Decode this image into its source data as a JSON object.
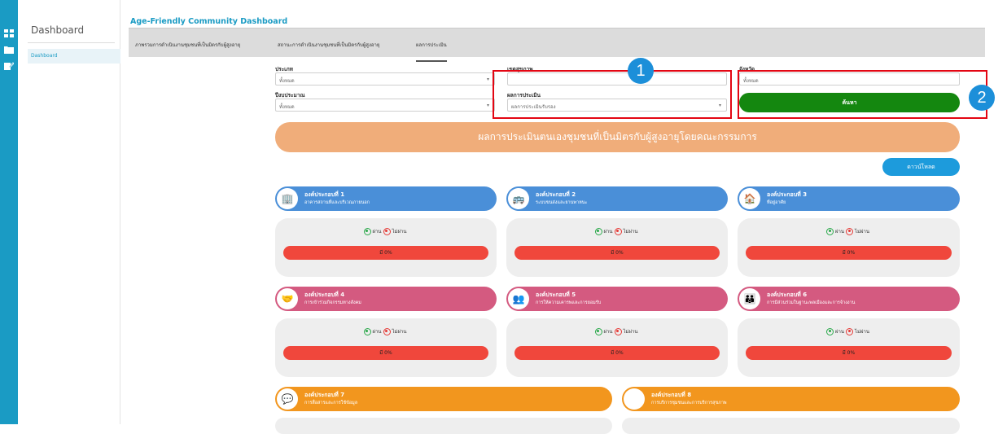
{
  "sidebar": {
    "title": "Dashboard",
    "items": [
      {
        "label": "Dashboard"
      }
    ]
  },
  "app_title": "Age-Friendly Community Dashboard",
  "tabs": [
    {
      "label": "ภาพรวมการดำเนินงานชุมชนที่เป็นมิตรกับผู้สูงอายุ"
    },
    {
      "label": "สถานะการดำเนินงานชุมชนที่เป็นมิตรกับผู้สูงอายุ"
    },
    {
      "label": "ผลการประเมิน"
    }
  ],
  "filters": {
    "type": {
      "label": "ประเภท",
      "value": "ทั้งหมด"
    },
    "health_zone": {
      "label": "เขตสุขภาพ",
      "value": ""
    },
    "province": {
      "label": "จังหวัด",
      "value": "ทั้งหมด"
    },
    "fiscal_year": {
      "label": "ปีงบประมาณ",
      "value": "ทั้งหมด"
    },
    "result": {
      "label": "ผลการประเมิน",
      "value": "ผลการประเมินรับรอง"
    }
  },
  "search_button": "ค้นหา",
  "annotations": [
    "1",
    "2"
  ],
  "banner": "ผลการประเมินตนเองชุมชนที่เป็นมิตรกับผู้สูงอายุโดยคณะกรรมการ",
  "download_button": "ดาวน์โหลด",
  "pass_label": "ผ่าน",
  "fail_label": "ไม่ผ่าน",
  "colors": {
    "blue": "#4a8fd8",
    "pink": "#d45a80",
    "orange": "#f2961e",
    "green": "#14870f",
    "red": "#f0473c"
  },
  "components": [
    {
      "title": "องค์ประกอบที่ 1",
      "subtitle": "อาคารสถานที่และบริเวณภายนอก",
      "icon": "building-icon",
      "bar": "มี 0%"
    },
    {
      "title": "องค์ประกอบที่ 2",
      "subtitle": "ระบบขนส่งและยานพาหนะ",
      "icon": "bus-icon",
      "bar": "มี 0%"
    },
    {
      "title": "องค์ประกอบที่ 3",
      "subtitle": "ที่อยู่อาศัย",
      "icon": "house-icon",
      "bar": "มี 0%"
    },
    {
      "title": "องค์ประกอบที่ 4",
      "subtitle": "การเข้าร่วมกิจกรรมทางสังคม",
      "icon": "handshake-icon",
      "bar": "มี 0%"
    },
    {
      "title": "องค์ประกอบที่ 5",
      "subtitle": "การให้ความเคารพและการยอมรับ",
      "icon": "people-icon",
      "bar": "มี 0%"
    },
    {
      "title": "องค์ประกอบที่ 6",
      "subtitle": "การมีส่วนร่วมในฐานะพลเมืองและการจ้างงาน",
      "icon": "group-icon",
      "bar": "มี 0%"
    },
    {
      "title": "องค์ประกอบที่ 7",
      "subtitle": "การสื่อสารและการใช้ข้อมูล",
      "icon": "chat-icon"
    },
    {
      "title": "องค์ประกอบที่ 8",
      "subtitle": "การบริการชุมชนและการบริการสุขภาพ",
      "icon": "health-icon"
    }
  ]
}
